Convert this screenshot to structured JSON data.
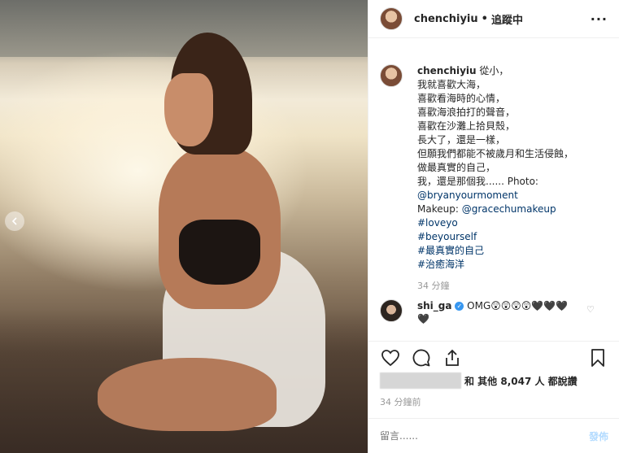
{
  "post": {
    "username": "chenchiyiu",
    "separator": "•",
    "follow_status": "追蹤中",
    "more_label": "···"
  },
  "caption": {
    "username": "chenchiyiu",
    "lines": [
      "從小，",
      "我就喜歡大海，",
      "喜歡看海時的心情，",
      "喜歡海浪拍打的聲音，",
      "喜歡在沙灘上拾貝殼，",
      "長大了，還是一樣，",
      "但願我們都能不被歲月和生活侵蝕，",
      "做最真實的自己，",
      "我，還是那個我...... Photo:"
    ],
    "photo_credit": "@bryanyourmoment",
    "makeup_label": "Makeup: ",
    "makeup_credit": "@gracechumakeup",
    "hashtags": [
      "#loveyo",
      "#beyourself",
      "#最真實的自己",
      "#治癒海洋"
    ],
    "time": "34 分鐘"
  },
  "comment": {
    "username": "shi_ga",
    "text": "OMG😲😲😲😲🖤🖤🖤🖤"
  },
  "likes": {
    "text": "和 其他 8,047 人 都說讚"
  },
  "time_ago": "34 分鐘前",
  "comment_input": {
    "placeholder": "留言......",
    "post_label": "發佈"
  },
  "icons": {
    "like": "heart-icon",
    "comment": "comment-icon",
    "share": "share-icon",
    "save": "bookmark-icon"
  }
}
